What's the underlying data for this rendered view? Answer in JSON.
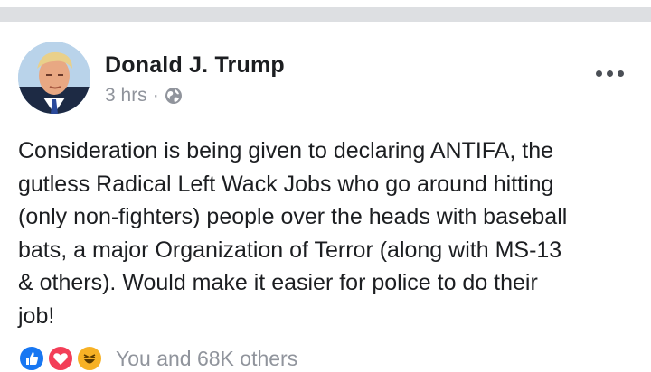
{
  "post": {
    "author_name": "Donald J. Trump",
    "timestamp": "3 hrs",
    "separator": "·",
    "privacy_icon": "globe-icon",
    "more_icon": "more-options-icon",
    "text": "Consideration is being given to declaring ANTIFA, the\ngutless Radical Left Wack Jobs who go around hitting\n(only non-fighters) people over the heads with baseball\nbats, a major Organization of Terror (along with MS-13\n& others). Would make it easier for police to do their\njob!",
    "reactions": {
      "icons": [
        "like-icon",
        "love-icon",
        "haha-icon"
      ],
      "summary": "You and 68K others"
    }
  },
  "colors": {
    "divider": "#dddfe2",
    "secondary_text": "#90949c",
    "primary_text": "#1c1e21",
    "like": "#1877f2",
    "love": "#f33e58",
    "haha": "#f7b125"
  }
}
